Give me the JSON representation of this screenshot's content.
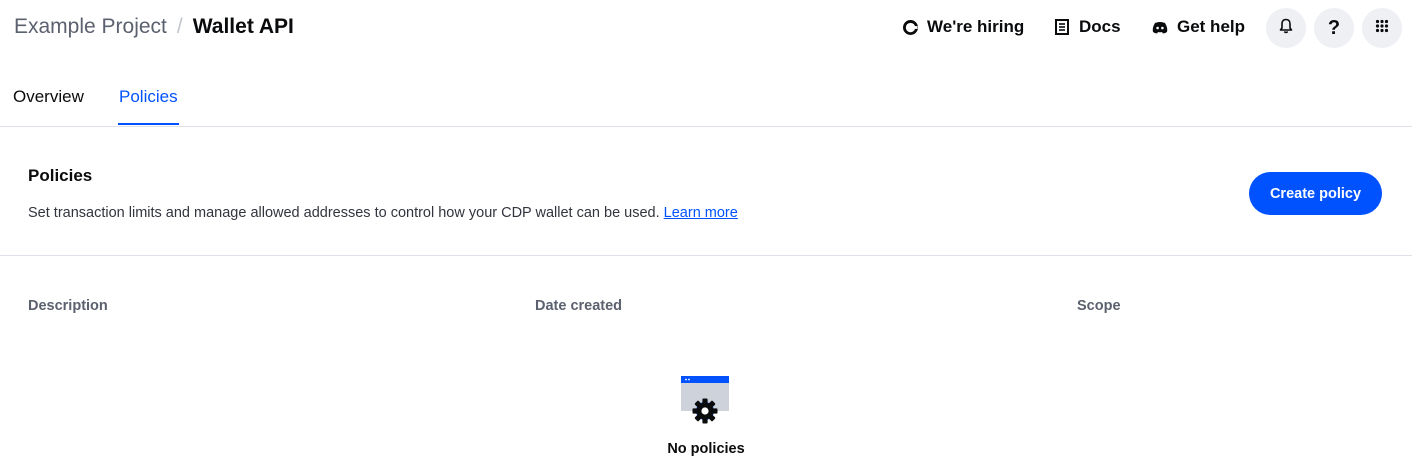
{
  "breadcrumb": {
    "project": "Example Project",
    "separator": "/",
    "current": "Wallet API"
  },
  "header": {
    "links": {
      "hiring": "We're hiring",
      "docs": "Docs",
      "help": "Get help"
    },
    "icons": {
      "hiring": "coinbase-c-icon",
      "docs": "document-icon",
      "help": "discord-icon",
      "bell": "bell-icon",
      "question": "question-icon",
      "apps": "grid-icon"
    },
    "question_glyph": "?"
  },
  "tabs": {
    "overview": "Overview",
    "policies": "Policies"
  },
  "policies": {
    "title": "Policies",
    "description": "Set transaction limits and manage allowed addresses to control how your CDP wallet can be used.",
    "learn_more": "Learn more",
    "create_button": "Create policy"
  },
  "table": {
    "columns": [
      "Description",
      "Date created",
      "Scope"
    ]
  },
  "empty_state": {
    "text": "No policies"
  },
  "colors": {
    "accent": "#0052ff",
    "text": "#0a0b0d",
    "muted": "#5b616e",
    "border": "#dee1e7",
    "button_bg": "#eef0f3"
  }
}
